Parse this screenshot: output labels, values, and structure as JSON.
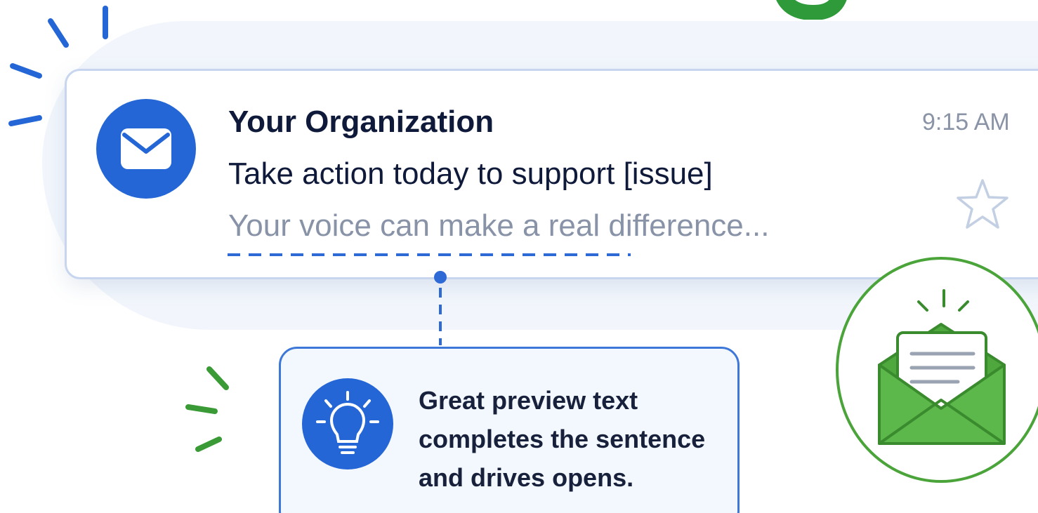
{
  "email": {
    "sender": "Your Organization",
    "subject": "Take action today to support [issue]",
    "preview": "Your voice can make a real difference...",
    "time": "9:15 AM"
  },
  "tip": {
    "text": "Great preview text completes the sentence and drives opens."
  },
  "icons": {
    "avatar": "envelope-icon",
    "star": "star-icon",
    "tip": "lightbulb-icon",
    "badge": "open-envelope-icon"
  },
  "colors": {
    "accent_blue": "#2466d6",
    "accent_green": "#4aa43a",
    "text_dark": "#0f1a3a",
    "text_muted": "#8893a8"
  }
}
